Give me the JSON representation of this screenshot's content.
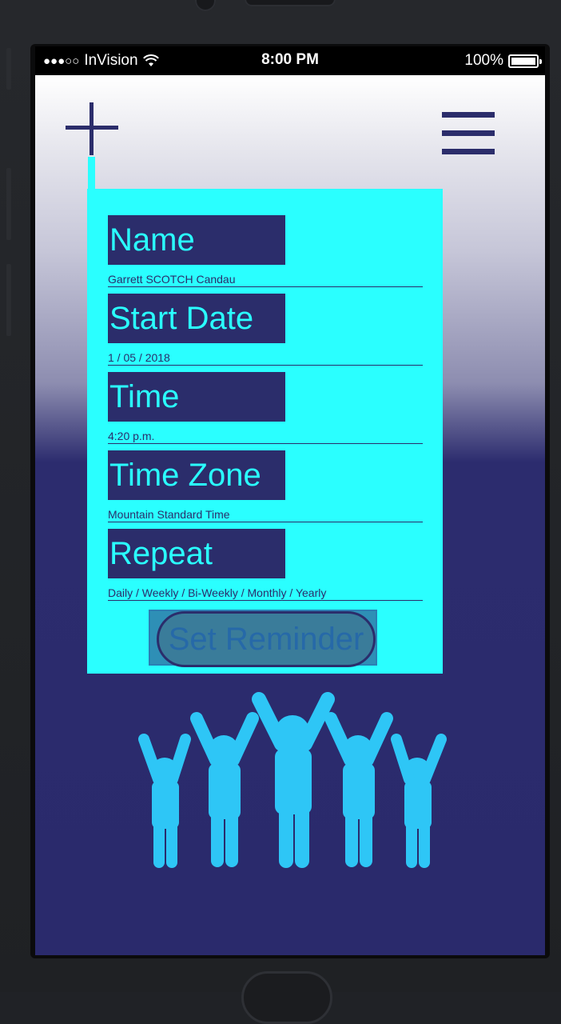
{
  "status_bar": {
    "carrier": "InVision",
    "time": "8:00 PM",
    "battery": "100%"
  },
  "header": {
    "add_icon": "plus-icon",
    "menu_icon": "hamburger-icon"
  },
  "form": {
    "fields": [
      {
        "label": "Name",
        "value": "Garrett SCOTCH Candau"
      },
      {
        "label": "Start Date",
        "value": "1 / 05 / 2018"
      },
      {
        "label": "Time",
        "value": "4:20 p.m."
      },
      {
        "label": "Time Zone",
        "value": "Mountain Standard Time"
      },
      {
        "label": "Repeat",
        "value": "Daily / Weekly / Bi-Weekly / Monthly / Yearly"
      }
    ],
    "submit_label": "Set Reminder"
  },
  "illustration": "people-celebrating-icon",
  "colors": {
    "accent_cyan": "#2affff",
    "navy": "#2b2d6b",
    "people_blue": "#2ec6f6"
  }
}
